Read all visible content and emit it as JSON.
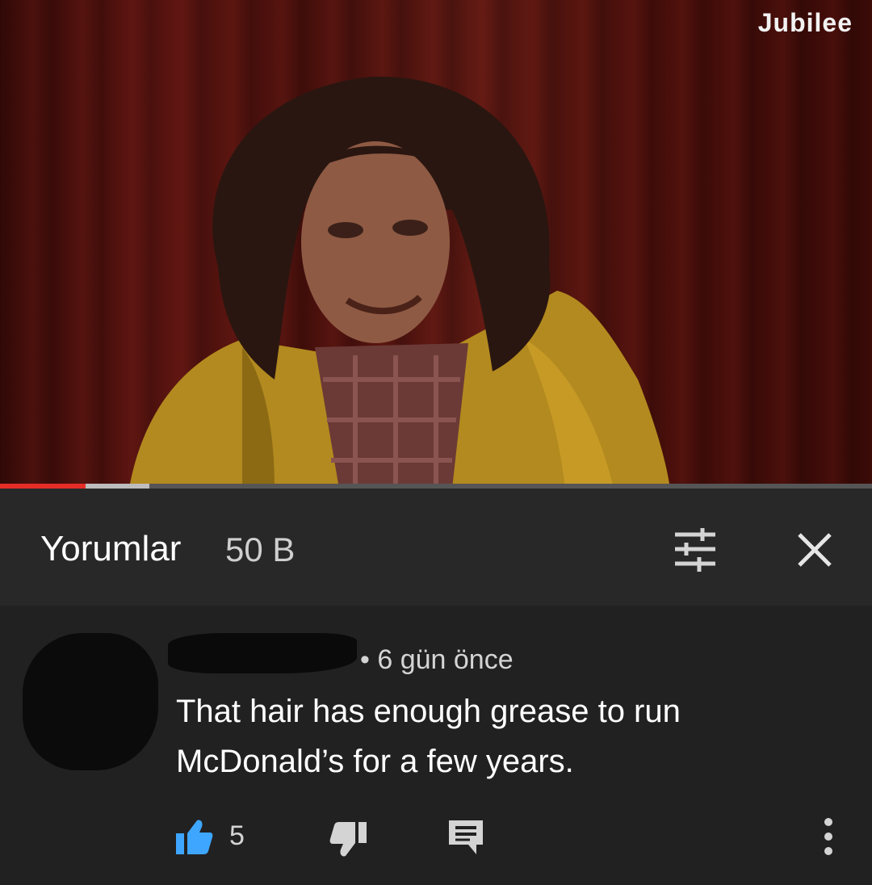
{
  "video": {
    "channel_watermark": "Jubilee",
    "progress_played": 0.098,
    "progress_buffered": 0.171
  },
  "comments_panel": {
    "title": "Yorumlar",
    "count": "50 B",
    "sort_icon": "sort-filter-icon",
    "close_icon": "close-icon"
  },
  "comment": {
    "meta": "• 6 gün önce",
    "text": "That hair has enough grease to run\nMcDonald’s for a few years.",
    "like_count": "5",
    "colors": {
      "like_accent": "#3ea6ff",
      "icon_gray": "#d4d4d4"
    }
  }
}
